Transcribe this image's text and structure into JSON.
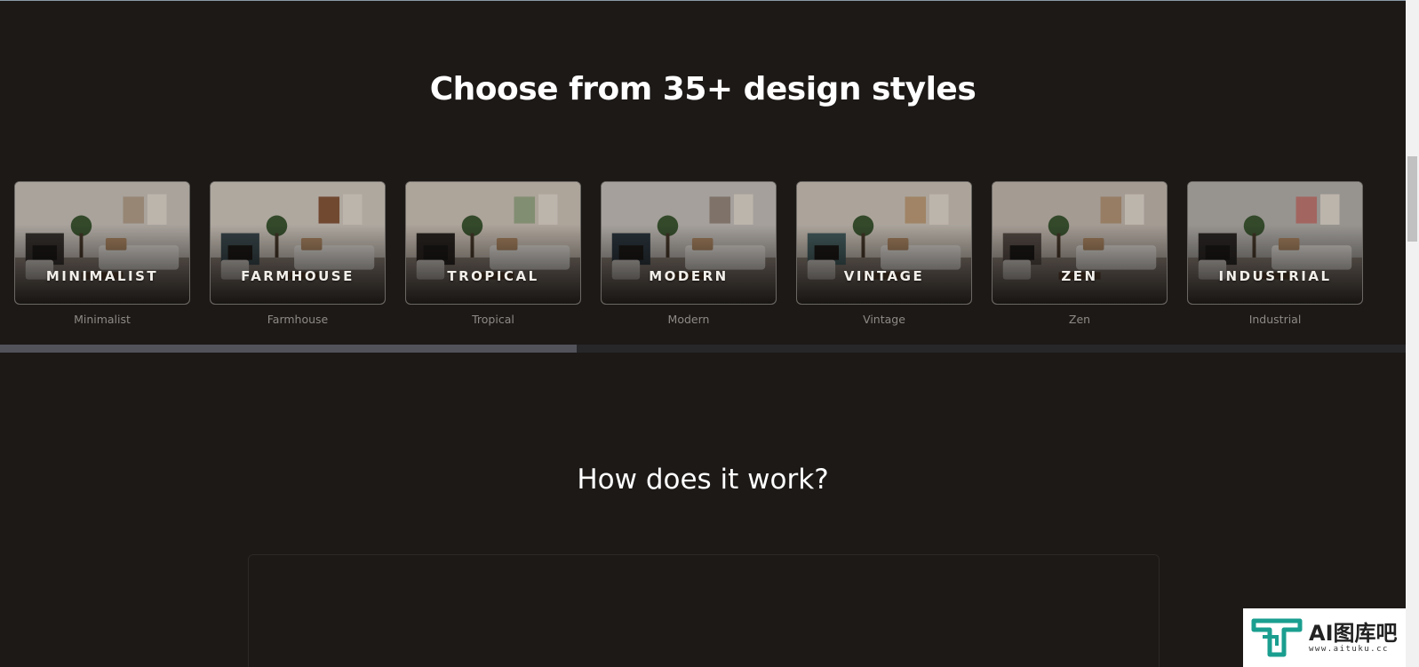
{
  "styles_section": {
    "title": "Choose from 35+ design styles",
    "cards": [
      {
        "label": "MINIMALIST",
        "caption": "Minimalist"
      },
      {
        "label": "FARMHOUSE",
        "caption": "Farmhouse"
      },
      {
        "label": "TROPICAL",
        "caption": "Tropical"
      },
      {
        "label": "MODERN",
        "caption": "Modern"
      },
      {
        "label": "VINTAGE",
        "caption": "Vintage"
      },
      {
        "label": "ZEN",
        "caption": "Zen"
      },
      {
        "label": "INDUSTRIAL",
        "caption": "Industrial"
      }
    ],
    "scroll_progress": 0.41
  },
  "how_section": {
    "title": "How does it work?"
  },
  "watermark": {
    "brand": "AI图库吧",
    "url": "www.aituku.cc"
  },
  "colors": {
    "background": "#1c1917",
    "progress_fill": "#52525b",
    "progress_track": "#27272a",
    "watermark_accent": "#1a9e8f"
  }
}
